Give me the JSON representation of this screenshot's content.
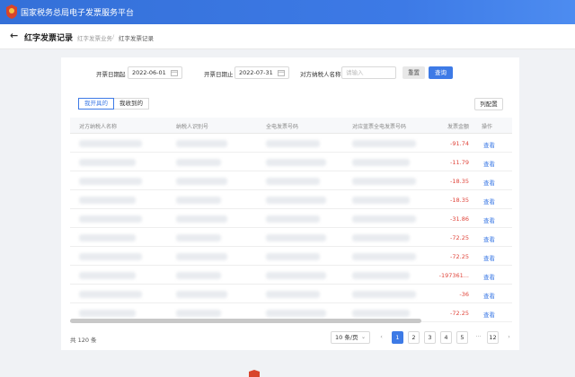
{
  "header": {
    "title": "国家税务总局电子发票服务平台",
    "logo_icon": "tax-emblem-icon"
  },
  "breadcrumb": {
    "back_icon": "arrow-left-icon",
    "page_title": "红字发票记录",
    "parent": "红字发票业务",
    "separator": "/",
    "current": "红字发票记录"
  },
  "filters": {
    "start_label": "开票日期起",
    "start_value": "2022-06-01",
    "end_label": "开票日期止",
    "end_value": "2022-07-31",
    "buyer_label": "对方纳税人名称",
    "buyer_placeholder": "请输入",
    "reset_label": "重置",
    "query_label": "查询"
  },
  "tabs": [
    {
      "label": "我开具的",
      "active": true
    },
    {
      "label": "我收到的",
      "active": false
    }
  ],
  "column_settings_label": "列配置",
  "table": {
    "headers": [
      "对方纳税人名称",
      "纳税人识别号",
      "全电发票号码",
      "对应蓝票全电发票号码",
      "发票金额",
      "操作"
    ],
    "rows": [
      {
        "amount": "-91.74",
        "action": "查看"
      },
      {
        "amount": "-11.79",
        "action": "查看"
      },
      {
        "amount": "-18.35",
        "action": "查看"
      },
      {
        "amount": "-18.35",
        "action": "查看"
      },
      {
        "amount": "-31.86",
        "action": "查看"
      },
      {
        "amount": "-72.25",
        "action": "查看"
      },
      {
        "amount": "-72.25",
        "action": "查看"
      },
      {
        "amount": "-197361...",
        "action": "查看"
      },
      {
        "amount": "-36",
        "action": "查看"
      },
      {
        "amount": "-72.25",
        "action": "查看"
      }
    ]
  },
  "footer": {
    "total": "共 120 条",
    "page_size": "10 条/页",
    "pages": [
      "1",
      "2",
      "3",
      "4",
      "5"
    ],
    "ellipsis": "···",
    "last_page": "12",
    "current_page": "1",
    "prev_icon": "chevron-left-icon",
    "next_icon": "chevron-right-icon"
  },
  "colors": {
    "primary": "#3d7ae6",
    "negative_amount": "#e0463c"
  }
}
